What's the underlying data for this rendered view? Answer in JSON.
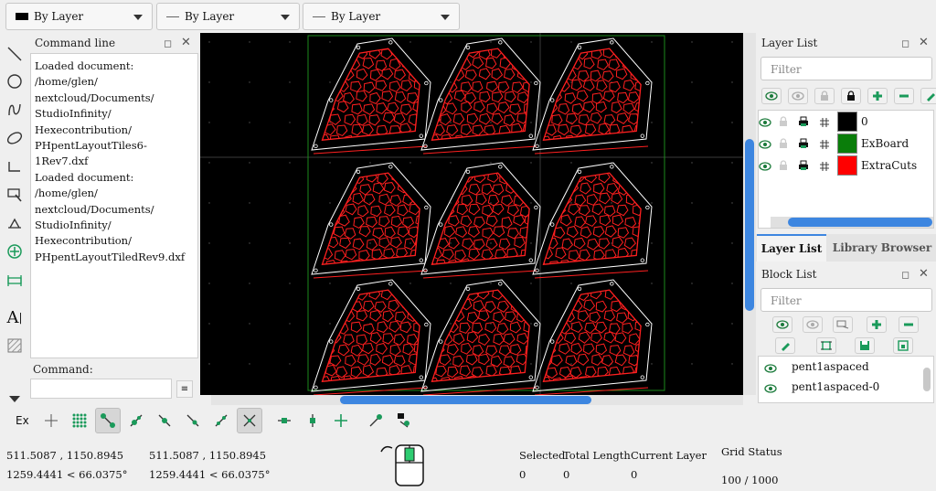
{
  "toolbar_top": {
    "combo_color": "By Layer",
    "combo_width": "By Layer",
    "combo_linetype": "By Layer"
  },
  "command_panel": {
    "title": "Command line",
    "log": "Loaded document: /home/glen/\nnextcloud/Documents/\nStudioInfinity/\nHexecontribution/\nPHpentLayoutTiles6-1Rev7.dxf\nLoaded document: /home/glen/\nnextcloud/Documents/\nStudioInfinity/\nHexecontribution/\nPHpentLayoutTiledRev9.dxf",
    "command_label": "Command:",
    "command_value": ""
  },
  "layer_panel": {
    "title": "Layer List",
    "filter_placeholder": "Filter",
    "layers": [
      {
        "name": "0",
        "color": "#000000"
      },
      {
        "name": "ExBoard",
        "color": "#0a7d0a"
      },
      {
        "name": "ExtraCuts",
        "color": "#ff0000"
      }
    ]
  },
  "tabs": {
    "layer_list": "Layer List",
    "library_browser": "Library Browser"
  },
  "block_panel": {
    "title": "Block List",
    "filter_placeholder": "Filter",
    "blocks": [
      "pent1aspaced",
      "pent1aspaced-0"
    ]
  },
  "snap_toolbar": {
    "ex_label": "Ex"
  },
  "status_bar": {
    "abs_coord": "511.5087 , 1150.8945",
    "abs_polar": "1259.4441 < 66.0375°",
    "rel_coord": "511.5087 , 1150.8945",
    "rel_polar": "1259.4441 < 66.0375°",
    "selected_label": "Selected",
    "selected_value": "0",
    "total_length_label": "Total Length",
    "total_length_value": "0",
    "current_layer_label": "Current Layer",
    "current_layer_value": "0",
    "grid_status_label": "Grid Status",
    "grid_status_value": "100 / 1000"
  },
  "colors": {
    "canvas_bg": "#000000",
    "tile_outline": "#ffffff",
    "cut_lines": "#ff2020",
    "accent_blue": "#3d86e0"
  },
  "icons": {
    "left_toolbar": [
      "line-icon",
      "circle-icon",
      "curve-icon",
      "ellipse-icon",
      "polyline-icon",
      "select-icon",
      "dimension-icon",
      "modify-icon",
      "measure-icon",
      "text-icon",
      "hatch-icon",
      "more-icon"
    ],
    "snap_toolbar": [
      "snap-free-icon",
      "snap-grid-icon",
      "snap-endpoint-icon",
      "snap-onentity-icon",
      "snap-center-icon",
      "snap-middle-icon",
      "snap-distance-icon",
      "snap-intersection-icon",
      "restrict-horizontal-icon",
      "restrict-vertical-icon",
      "restrict-orthogonal-icon",
      "relative-zero-icon",
      "lock-relative-zero-icon"
    ]
  }
}
